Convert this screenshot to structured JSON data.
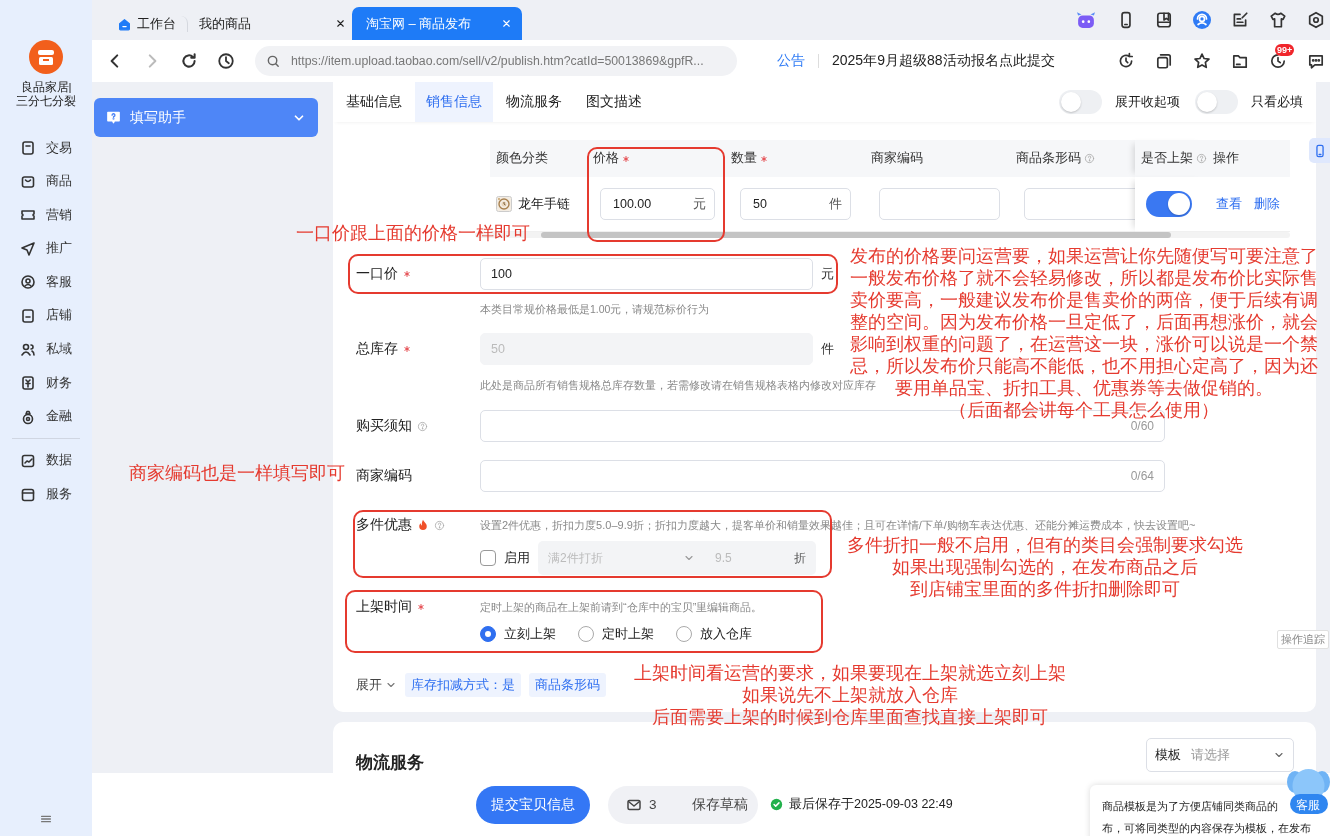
{
  "shop": {
    "name": "良品家居|",
    "subtitle": "三分七分裂"
  },
  "nav": [
    {
      "label": "交易"
    },
    {
      "label": "商品"
    },
    {
      "label": "营销"
    },
    {
      "label": "推广"
    },
    {
      "label": "客服"
    },
    {
      "label": "店铺"
    },
    {
      "label": "私域"
    },
    {
      "label": "财务"
    },
    {
      "label": "金融"
    },
    {
      "label": "数据"
    },
    {
      "label": "服务"
    }
  ],
  "browser_tabs": [
    {
      "label": "工作台",
      "selected": false
    },
    {
      "label": "我的商品",
      "selected": false
    },
    {
      "label": "淘宝网 – 商品发布",
      "selected": true
    }
  ],
  "address_bar": {
    "url": "https://item.upload.taobao.com/sell/v2/publish.htm?catId=50013869&gpfR...",
    "forward_enabled": false
  },
  "notice": {
    "label": "公告",
    "text": "2025年9月超级88活动报名点此提交"
  },
  "badge": "99+",
  "helper": {
    "label": "填写助手"
  },
  "section_tabs": [
    {
      "label": "基础信息",
      "selected": false
    },
    {
      "label": "销售信息",
      "selected": true
    },
    {
      "label": "物流服务",
      "selected": false
    },
    {
      "label": "图文描述",
      "selected": false
    }
  ],
  "toggles": [
    {
      "label": "展开收起项",
      "on": false
    },
    {
      "label": "只看必填",
      "on": false
    }
  ],
  "sku_table": {
    "columns": [
      {
        "label": "颜色分类",
        "required": false,
        "help": false
      },
      {
        "label": "价格",
        "required": true,
        "help": false
      },
      {
        "label": "数量",
        "required": true,
        "help": false
      },
      {
        "label": "商家编码",
        "required": false,
        "help": false
      },
      {
        "label": "商品条形码",
        "required": false,
        "help": true
      },
      {
        "label": "是否上架",
        "required": false,
        "help": true
      },
      {
        "label": "操作",
        "required": false,
        "help": false
      }
    ],
    "rows": [
      {
        "name": "龙年手链",
        "price": "100.00",
        "price_unit": "元",
        "quantity": "50",
        "quantity_unit": "件",
        "listed": true,
        "actions": [
          "查看",
          "删除"
        ]
      }
    ]
  },
  "form": {
    "fields": [
      {
        "kind": "text",
        "label": "一口价",
        "required": true,
        "help": false,
        "value": "100",
        "unit": "元",
        "disabled": false,
        "hint": "本类目常规价格最低是1.00元，请规范标价行为"
      },
      {
        "kind": "text",
        "label": "总库存",
        "required": true,
        "help": false,
        "value": "50",
        "unit": "件",
        "disabled": true,
        "hint": "此处是商品所有销售规格总库存数量，若需修改请在销售规格表格内修改对应库存"
      },
      {
        "kind": "text",
        "label": "购买须知",
        "required": false,
        "help": true,
        "counter": "0/60",
        "disabled": false
      },
      {
        "kind": "text",
        "label": "商家编码",
        "required": false,
        "help": false,
        "counter": "0/64",
        "disabled": false
      },
      {
        "kind": "discount",
        "label": "多件优惠",
        "required": false,
        "hot": true,
        "help": true,
        "description": "设置2件优惠，折扣力度5.0–9.9折；折扣力度越大，提客单价和销量效果越佳；且可在详情/下单/购物车表达优惠、还能分摊运费成本，快去设置吧~",
        "enable_label": "启用",
        "checked": false,
        "disabled": true,
        "rule": "满2件打折",
        "discount": "9.5",
        "discount_unit": "折"
      },
      {
        "kind": "radio",
        "label": "上架时间",
        "required": true,
        "help": false,
        "hint": "定时上架的商品在上架前请到“仓库中的宝贝”里编辑商品。",
        "options": [
          {
            "label": "立刻上架",
            "selected": true
          },
          {
            "label": "定时上架",
            "selected": false
          },
          {
            "label": "放入仓库",
            "selected": false
          }
        ]
      }
    ]
  },
  "expand": {
    "label": "展开",
    "tags": [
      "库存扣减方式：是",
      "商品条形码"
    ]
  },
  "logistics": {
    "title": "物流服务",
    "template_label": "模板",
    "template_placeholder": "请选择"
  },
  "footer": {
    "submit": "提交宝贝信息",
    "message_count": "3",
    "save_draft": "保存草稿",
    "saved": "最后保存于2025-09-03 22:49"
  },
  "tooltip": {
    "lines": [
      "商品模板是为了方便店铺同类商品的",
      "布，可将同类型的内容保存为模板，在发布"
    ]
  },
  "floating": {
    "service": "客服",
    "trace": "操作追踪"
  },
  "annotations": [
    {
      "lines": [
        "一口价跟上面的价格一样即可"
      ]
    },
    {
      "lines": [
        "发布的价格要问运营要，如果运营让你先随便写可要注意了",
        "一般发布价格了就不会轻易修改，所以都是发布价比实际售",
        "卖价要高，一般建议发布价是售卖价的两倍，便于后续有调",
        "整的空间。因为发布价格一旦定低了，后面再想涨价，就会",
        "影响到权重的问题了，在运营这一块，涨价可以说是一个禁",
        "忌，所以发布价只能高不能低，也不用担心定高了，因为还",
        "要用单品宝、折扣工具、优惠券等去做促销的。",
        "（后面都会讲每个工具怎么使用）"
      ]
    },
    {
      "lines": [
        "商家编码也是一样填写即可"
      ]
    },
    {
      "lines": [
        "多件折扣一般不启用，但有的类目会强制要求勾选",
        "如果出现强制勾选的，在发布商品之后",
        "到店铺宝里面的多件折扣删除即可"
      ]
    },
    {
      "lines": [
        "上架时间看运营的要求，如果要现在上架就选立刻上架",
        "如果说先不上架就放入仓库",
        "后面需要上架的时候到仓库里面查找直接上架即可"
      ]
    }
  ]
}
